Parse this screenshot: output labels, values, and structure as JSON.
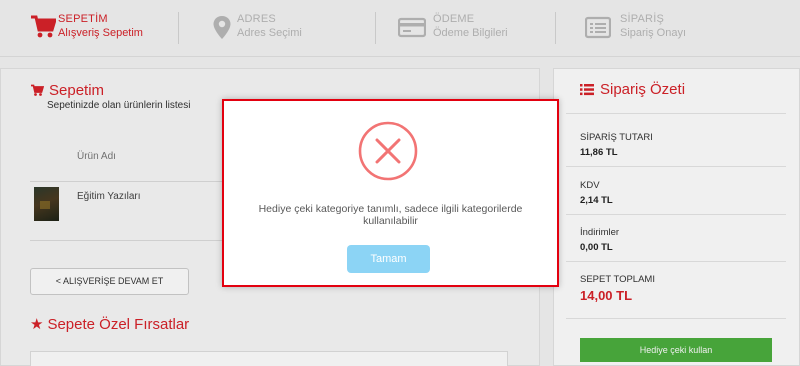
{
  "steps": [
    {
      "title": "SEPETİM",
      "subtitle": "Alışveriş Sepetim",
      "state": "active",
      "icon": "cart-icon"
    },
    {
      "title": "ADRES",
      "subtitle": "Adres Seçimi",
      "state": "inactive",
      "icon": "map-pin-icon"
    },
    {
      "title": "ÖDEME",
      "subtitle": "Ödeme Bilgileri",
      "state": "inactive",
      "icon": "credit-card-icon"
    },
    {
      "title": "SİPARİŞ",
      "subtitle": "Sipariş Onayı",
      "state": "inactive",
      "icon": "order-list-icon"
    }
  ],
  "cart": {
    "title": "Sepetim",
    "subtitle": "Sepetinizde olan ürünlerin listesi",
    "column_header": "Ürün Adı",
    "items": [
      {
        "name": "Eğitim Yazıları"
      }
    ],
    "continue_label": "< ALIŞVERİŞE DEVAM ET"
  },
  "deals": {
    "title": "Sepete Özel Fırsatlar"
  },
  "summary": {
    "title": "Sipariş Özeti",
    "rows": [
      {
        "label": "SİPARİŞ TUTARI",
        "value": "11,86 TL"
      },
      {
        "label": "KDV",
        "value": "2,14 TL"
      },
      {
        "label": "İndirimler",
        "value": "0,00 TL"
      }
    ],
    "total_label": "SEPET TOPLAMI",
    "total_value": "14,00 TL",
    "gift_button": "Hediye çeki kullan"
  },
  "modal": {
    "icon": "error-x-icon",
    "message": "Hediye çeki kategoriye tanımlı, sadece ilgili kategorilerde kullanılabilir",
    "ok_label": "Tamam"
  },
  "colors": {
    "accent": "#d8232a",
    "modal_border": "#e3000f",
    "ok_button": "#8cd4f5",
    "gift_button": "#4caf3e",
    "error_icon": "#f27474"
  }
}
